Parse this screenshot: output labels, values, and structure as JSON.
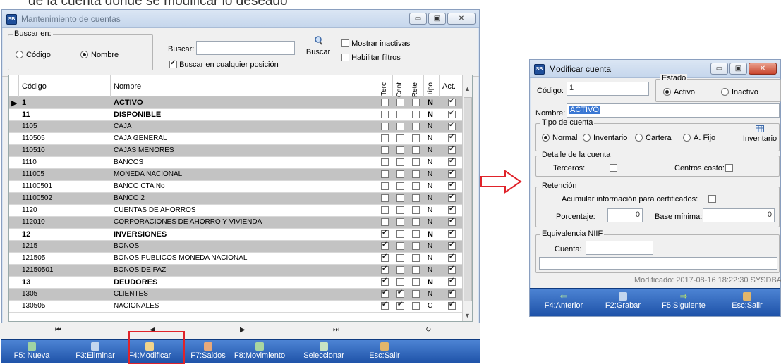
{
  "top_strip": {
    "text": "de la cuenta donde se modificar lo deseado"
  },
  "main": {
    "title": "Mantenimiento de cuentas",
    "buscar_en": {
      "legend": "Buscar en:",
      "codigo": "Código",
      "nombre": "Nombre",
      "selected": "nombre"
    },
    "buscar_label": "Buscar:",
    "buscar_value": "",
    "buscar_button": "Buscar",
    "cualquier_pos": "Buscar en cualquier posición",
    "mostrar_inactivas": "Mostrar inactivas",
    "habilitar_filtros": "Habilitar filtros",
    "columns": {
      "codigo": "Código",
      "nombre": "Nombre",
      "terc": "Terc",
      "cent": "Cent",
      "rete": "Rete",
      "tipo": "Tipo",
      "act": "Act."
    },
    "rows": [
      {
        "codigo": "1",
        "nombre": "ACTIVO",
        "terc": false,
        "cent": false,
        "rete": false,
        "tipo": "N",
        "act": true,
        "bold": true,
        "gray": true,
        "current": true
      },
      {
        "codigo": "11",
        "nombre": "DISPONIBLE",
        "terc": false,
        "cent": false,
        "rete": false,
        "tipo": "N",
        "act": true,
        "bold": true,
        "gray": false
      },
      {
        "codigo": "1105",
        "nombre": "CAJA",
        "terc": false,
        "cent": false,
        "rete": false,
        "tipo": "N",
        "act": true,
        "bold": false,
        "gray": true
      },
      {
        "codigo": "110505",
        "nombre": "CAJA GENERAL",
        "terc": false,
        "cent": false,
        "rete": false,
        "tipo": "N",
        "act": true,
        "bold": false,
        "gray": false
      },
      {
        "codigo": "110510",
        "nombre": "CAJAS MENORES",
        "terc": false,
        "cent": false,
        "rete": false,
        "tipo": "N",
        "act": true,
        "bold": false,
        "gray": true
      },
      {
        "codigo": "1110",
        "nombre": "BANCOS",
        "terc": false,
        "cent": false,
        "rete": false,
        "tipo": "N",
        "act": true,
        "bold": false,
        "gray": false
      },
      {
        "codigo": "111005",
        "nombre": "MONEDA NACIONAL",
        "terc": false,
        "cent": false,
        "rete": false,
        "tipo": "N",
        "act": true,
        "bold": false,
        "gray": true
      },
      {
        "codigo": "11100501",
        "nombre": "BANCO  CTA No",
        "terc": false,
        "cent": false,
        "rete": false,
        "tipo": "N",
        "act": true,
        "bold": false,
        "gray": false
      },
      {
        "codigo": "11100502",
        "nombre": "BANCO 2",
        "terc": false,
        "cent": false,
        "rete": false,
        "tipo": "N",
        "act": true,
        "bold": false,
        "gray": true
      },
      {
        "codigo": "1120",
        "nombre": "CUENTAS DE AHORROS",
        "terc": false,
        "cent": false,
        "rete": false,
        "tipo": "N",
        "act": true,
        "bold": false,
        "gray": false
      },
      {
        "codigo": "112010",
        "nombre": "CORPORACIONES DE AHORRO Y VIVIENDA",
        "terc": false,
        "cent": false,
        "rete": false,
        "tipo": "N",
        "act": true,
        "bold": false,
        "gray": true
      },
      {
        "codigo": "12",
        "nombre": "INVERSIONES",
        "terc": true,
        "cent": false,
        "rete": false,
        "tipo": "N",
        "act": true,
        "bold": true,
        "gray": false
      },
      {
        "codigo": "1215",
        "nombre": "BONOS",
        "terc": true,
        "cent": false,
        "rete": false,
        "tipo": "N",
        "act": true,
        "bold": false,
        "gray": true
      },
      {
        "codigo": "121505",
        "nombre": "BONOS PUBLICOS MONEDA NACIONAL",
        "terc": true,
        "cent": false,
        "rete": false,
        "tipo": "N",
        "act": true,
        "bold": false,
        "gray": false
      },
      {
        "codigo": "12150501",
        "nombre": "BONOS DE PAZ",
        "terc": true,
        "cent": false,
        "rete": false,
        "tipo": "N",
        "act": true,
        "bold": false,
        "gray": true
      },
      {
        "codigo": "13",
        "nombre": "DEUDORES",
        "terc": true,
        "cent": false,
        "rete": false,
        "tipo": "N",
        "act": true,
        "bold": true,
        "gray": false
      },
      {
        "codigo": "1305",
        "nombre": "CLIENTES",
        "terc": true,
        "cent": true,
        "rete": false,
        "tipo": "N",
        "act": true,
        "bold": false,
        "gray": true
      },
      {
        "codigo": "130505",
        "nombre": "NACIONALES",
        "terc": true,
        "cent": true,
        "rete": false,
        "tipo": "C",
        "act": true,
        "bold": false,
        "gray": false
      }
    ],
    "toolbar": [
      "F5: Nueva",
      "F3:Eliminar",
      "F4:Modificar",
      "F7:Saldos",
      "F8:Movimiento",
      "Seleccionar",
      "Esc:Salir"
    ]
  },
  "dialog": {
    "title": "Modificar cuenta",
    "codigo_label": "Código:",
    "codigo_value": "1",
    "estado_legend": "Estado",
    "activo": "Activo",
    "inactivo": "Inactivo",
    "nombre_label": "Nombre:",
    "nombre_value": "ACTIVO",
    "tipo_legend": "Tipo de cuenta",
    "tipo_options": [
      "Normal",
      "Inventario",
      "Cartera",
      "A. Fijo"
    ],
    "inventario_btn": "Inventario",
    "detalle_legend": "Detalle de la cuenta",
    "terceros": "Terceros:",
    "centros_costo": "Centros costo:",
    "retencion_legend": "Retención",
    "acumular": "Acumular información para certificados:",
    "porcentaje_label": "Porcentaje:",
    "porcentaje_value": "0",
    "base_label": "Base mínima:",
    "base_value": "0",
    "niif_legend": "Equivalencia NIIF",
    "cuenta_label": "Cuenta:",
    "cuenta_value": "",
    "modificado": "Modificado: 2017-08-16  18:22:30  SYSDBA",
    "toolbar": [
      "F4:Anterior",
      "F2:Grabar",
      "F5:Siguiente",
      "Esc:Salir"
    ]
  },
  "colors": {
    "toolbar": "#2f65bb",
    "highlight": "#e0232a",
    "arrow": "#e0232a"
  }
}
